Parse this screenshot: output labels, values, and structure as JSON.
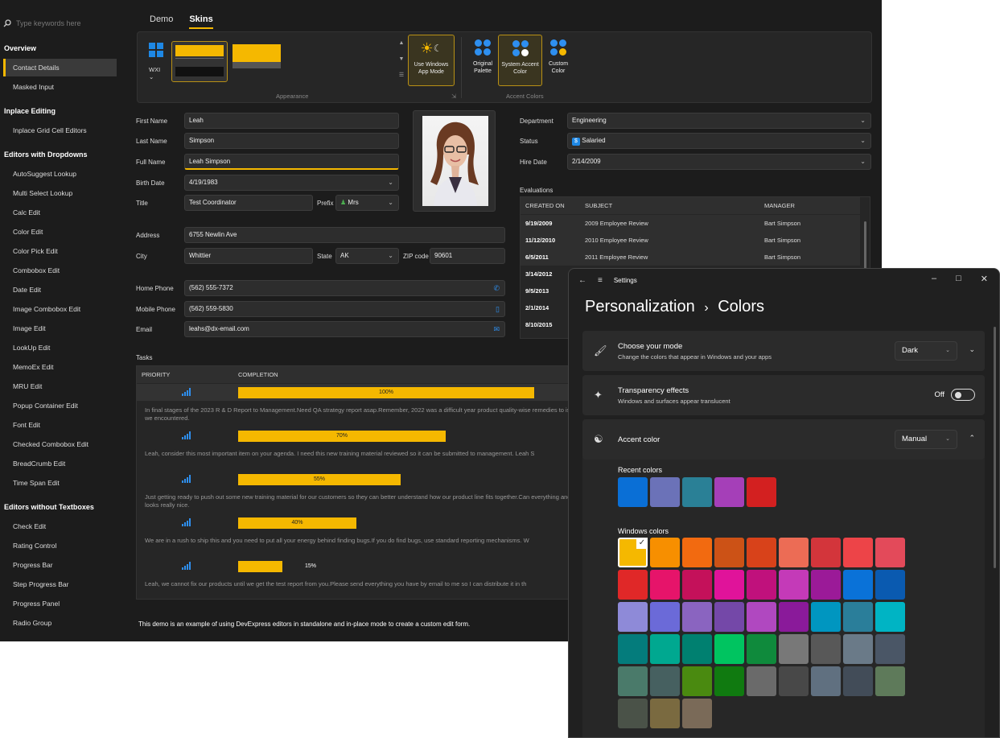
{
  "sidebar": {
    "search_placeholder": "Type keywords here",
    "groups": [
      "Overview",
      "Inplace Editing",
      "Editors with Dropdowns",
      "Editors without Textboxes"
    ],
    "overview_items": [
      "Contact Details",
      "Masked Input"
    ],
    "inplace_items": [
      "Inplace Grid Cell Editors"
    ],
    "dropdown_items": [
      "AutoSuggest Lookup",
      "Multi Select Lookup",
      "Calc Edit",
      "Color Edit",
      "Color Pick Edit",
      "Combobox Edit",
      "Date Edit",
      "Image Combobox Edit",
      "Image Edit",
      "LookUp Edit",
      "MemoEx Edit",
      "MRU Edit",
      "Popup Container Edit",
      "Font Edit",
      "Checked Combobox Edit",
      "BreadCrumb Edit",
      "Time Span Edit"
    ],
    "textbox_items": [
      "Check Edit",
      "Rating Control",
      "Progress Bar",
      "Step Progress Bar",
      "Progress Panel",
      "Radio Group"
    ]
  },
  "tabs": [
    "Demo",
    "Skins"
  ],
  "ribbon": {
    "skin_name": "WXI",
    "use_windows_mode": "Use Windows App Mode",
    "original_palette": "Original Palette",
    "system_accent": "System Accent Color",
    "custom_color": "Custom Color",
    "appearance_caption": "Appearance",
    "accent_caption": "Accent Colors",
    "accent_color": "#2e8ff0",
    "skin_color": "#f5b800"
  },
  "form": {
    "first_name_label": "First Name",
    "first_name": "Leah",
    "last_name_label": "Last Name",
    "last_name": "Simpson",
    "full_name_label": "Full Name",
    "full_name": "Leah Simpson",
    "birth_date_label": "Birth Date",
    "birth_date": "4/19/1983",
    "title_label": "Title",
    "title": "Test Coordinator",
    "prefix_label": "Prefix",
    "prefix": "Mrs",
    "address_label": "Address",
    "address": "6755 Newlin Ave",
    "city_label": "City",
    "city": "Whittier",
    "state_label": "State",
    "state": "AK",
    "zip_label": "ZIP code",
    "zip": "90601",
    "home_phone_label": "Home Phone",
    "home_phone": "(562) 555-7372",
    "mobile_phone_label": "Mobile Phone",
    "mobile_phone": "(562) 559-5830",
    "email_label": "Email",
    "email": "leahs@dx-email.com",
    "department_label": "Department",
    "department": "Engineering",
    "status_label": "Status",
    "status": "Salaried",
    "hire_date_label": "Hire Date",
    "hire_date": "2/14/2009",
    "evaluations_label": "Evaluations"
  },
  "evaluations": {
    "headers": [
      "CREATED ON",
      "SUBJECT",
      "MANAGER"
    ],
    "rows": [
      {
        "date": "9/19/2009",
        "subject": "2009 Employee Review",
        "manager": "Bart Simpson"
      },
      {
        "date": "11/12/2010",
        "subject": "2010 Employee Review",
        "manager": "Bart Simpson"
      },
      {
        "date": "6/5/2011",
        "subject": "2011 Employee Review",
        "manager": "Bart Simpson"
      },
      {
        "date": "3/14/2012",
        "subject": "",
        "manager": ""
      },
      {
        "date": "9/5/2013",
        "subject": "",
        "manager": ""
      },
      {
        "date": "2/1/2014",
        "subject": "",
        "manager": ""
      },
      {
        "date": "8/10/2015",
        "subject": "",
        "manager": ""
      }
    ]
  },
  "tasks": {
    "label": "Tasks",
    "headers": [
      "PRIORITY",
      "COMPLETION"
    ],
    "rows": [
      {
        "completion": 1.0,
        "pct": "100%",
        "desc": "In final stages of the 2023 R & D Report to Management.Need QA strategy report asap.Remember, 2022 was a difficult year product quality-wise remedies to issues we encountered."
      },
      {
        "completion": 0.7,
        "pct": "70%",
        "desc": "Leah, consider this most important item on your agenda. I need this new training material reviewed so it can be submitted to management. Leah S"
      },
      {
        "completion": 0.55,
        "pct": "55%",
        "desc": "Just getting ready to push out some new training material for our customers so they can better understand how our product line fits together.Can everything and it looks really nice."
      },
      {
        "completion": 0.4,
        "pct": "40%",
        "desc": "We are in a rush to ship this and you need to put all your energy behind finding bugs.If you do find bugs, use standard reporting mechanisms. W"
      },
      {
        "completion": 0.15,
        "pct": "15%",
        "desc": "Leah, we cannot fix our products until we get the test report from you.Please send everything you have by email to me so I can distribute it in th"
      }
    ]
  },
  "footer": "This demo is an example of using DevExpress editors in standalone and in-place mode to create a custom edit form.",
  "settings": {
    "app_title": "Settings",
    "breadcrumb_parent": "Personalization",
    "breadcrumb_sep": "›",
    "breadcrumb_current": "Colors",
    "mode_title": "Choose your mode",
    "mode_desc": "Change the colors that appear in Windows and your apps",
    "mode_value": "Dark",
    "transparency_title": "Transparency effects",
    "transparency_desc": "Windows and surfaces appear translucent",
    "transparency_value": "Off",
    "accent_title": "Accent color",
    "accent_value": "Manual",
    "recent_label": "Recent colors",
    "windows_label": "Windows colors",
    "recent_colors": [
      "#0a6fd6",
      "#6b72b8",
      "#2a8096",
      "#a53fb8",
      "#d32020"
    ],
    "windows_colors": [
      [
        "#f5b800",
        "#f78f00",
        "#f26a10",
        "#cc5216",
        "#d8421a",
        "#ec6c55",
        "#d3353b",
        "#ed4448",
        "#e34a5a"
      ],
      [
        "#e02828",
        "#e6146a",
        "#c4115a",
        "#e0139a",
        "#c0117c",
        "#c43ab8",
        "#9b1a98",
        "#0a72d8",
        "#0a5ab0"
      ],
      [
        "#8e8ad8",
        "#6b6ad8",
        "#8a64c0",
        "#7448a8",
        "#b048c0",
        "#8a1a9a",
        "#0096c0",
        "#2a7e9a",
        "#00b4c4"
      ],
      [
        "#047c7c",
        "#00a890",
        "#008070",
        "#00c460",
        "#0f8a3c",
        "#787878",
        "#585858",
        "#6a7a88",
        "#4a5666"
      ],
      [
        "#4a7a6a",
        "#466060",
        "#4a8a10",
        "#107a10",
        "#6a6a6a",
        "#484848",
        "#607080",
        "#424c58",
        "#5e7a5a"
      ],
      [
        "#4a5248",
        "#7a6a40",
        "#7a6a58"
      ]
    ]
  }
}
